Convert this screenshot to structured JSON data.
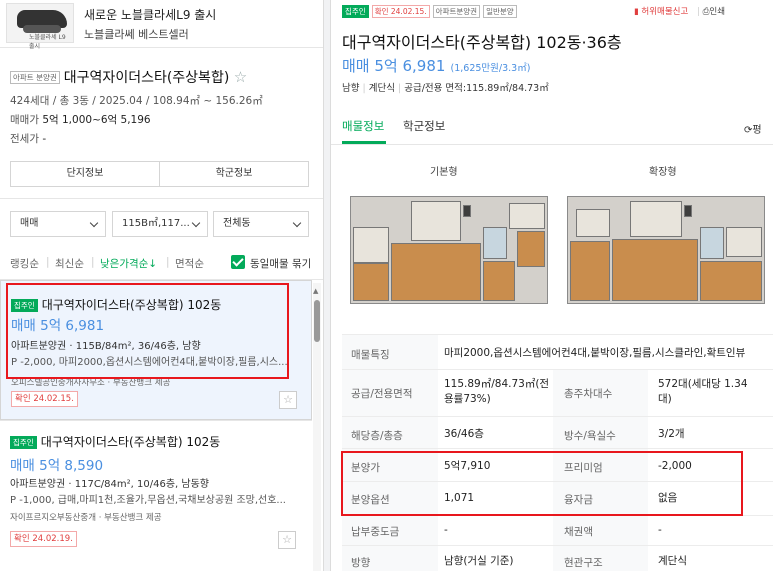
{
  "ad": {
    "title": "새로운 노블클라세L9 출시",
    "subtitle": "노블클라쎄 베스트셀러",
    "caption": "노블클라세 L9 출시"
  },
  "complex": {
    "tag": "아파트 분양권",
    "name": "대구역자이더스타(주상복합)",
    "info": "424세대 / 총 3동 / 2025.04 / 108.94㎡ ~ 156.26㎡",
    "sale_label": "매매가",
    "sale_value": "5억 1,000~6억 5,196",
    "jeonse_label": "전세가",
    "jeonse_value": "-"
  },
  "buttons": {
    "complex_info": "단지정보",
    "school_info": "학군정보"
  },
  "filters": {
    "trade": "매매",
    "area": "115B㎡,117...",
    "dong": "전체동"
  },
  "sort": {
    "items": [
      "랭킹순",
      "최신순",
      "낮은가격순↓",
      "면적순"
    ],
    "active": "낮은가격순↓",
    "group_label": "동일매물 묶기"
  },
  "listings": [
    {
      "badge": "집주인",
      "title": "대구역자이더스타(주상복합) 102동",
      "price": "매매 5억 6,981",
      "spec": "아파트분양권 · 115B/84m², 36/46층, 남향",
      "desc": "P -2,000, 마피2000,옵션시스템에어컨4대,붙박이장,필름,시스...",
      "agent": "오피스텔공인중개사사무소 · 부동산뱅크 제공",
      "confirm": "확인 24.02.15."
    },
    {
      "badge": "집주인",
      "title": "대구역자이더스타(주상복합) 102동",
      "price": "매매 5억 8,590",
      "spec": "아파트분양권 · 117C/84m², 10/46층, 남동향",
      "desc": "P -1,000, 급매,마피1천,조율가,무옵션,국채보상공원 조망,선호...",
      "agent": "자이프르지오부동산중개 · 부동산뱅크 제공",
      "confirm": "확인 24.02.19."
    }
  ],
  "detail": {
    "badge": "집주인",
    "confirm": "확인 24.02.15.",
    "tags": [
      "아파트분양권",
      "일반분양"
    ],
    "report": "허위매물신고",
    "print": "인쇄",
    "title": "대구역자이더스타(주상복합) 102동·36층",
    "price": "매매 5억 6,981",
    "unit_price": "(1,625만원/3.3㎡)",
    "brief": [
      "남향",
      "계단식",
      "공급/전용 면적:115.89㎡/84.73㎡"
    ],
    "tabs": [
      "매물정보",
      "학군정보"
    ],
    "active_tab": "매물정보",
    "refresh": "평",
    "plans": [
      "기본형",
      "확장형"
    ],
    "rows": [
      {
        "label": "매물특징",
        "value": "마피2000,옵션시스템에어컨4대,붙박이장,필름,시스클라인,확트인뷰"
      },
      {
        "label": "공급/전용면적",
        "value": "115.89㎡/84.73㎡(전용률73%)",
        "label2": "총주차대수",
        "value2": "572대(세대당 1.34대)"
      },
      {
        "label": "해당층/총층",
        "value": "36/46층",
        "label2": "방수/욕실수",
        "value2": "3/2개"
      },
      {
        "label": "분양가",
        "value": "5억7,910",
        "label2": "프리미엄",
        "value2": "-2,000"
      },
      {
        "label": "분양옵션",
        "value": "1,071",
        "label2": "융자금",
        "value2": "없음"
      },
      {
        "label": "납부중도금",
        "value": "-",
        "label2": "채권액",
        "value2": "-"
      },
      {
        "label": "방향",
        "value": "남향(거실 기준)",
        "label2": "현관구조",
        "value2": "계단식"
      }
    ]
  },
  "colors": {
    "accent_green": "#03aa5a",
    "price_blue": "#4a8fe0",
    "highlight_red": "#e8171d"
  }
}
